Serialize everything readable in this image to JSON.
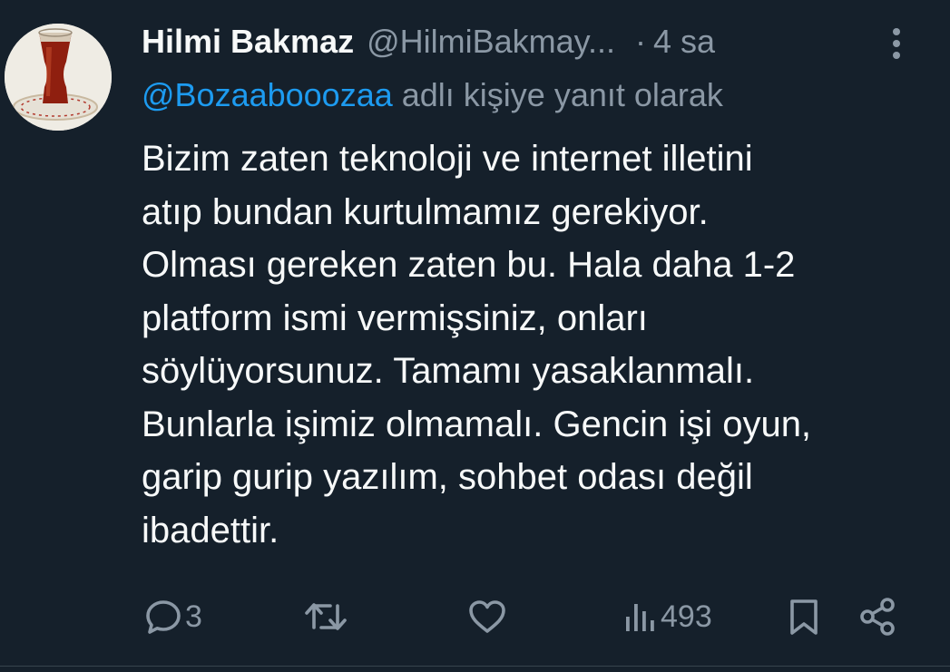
{
  "tweet": {
    "author_name": "Hilmi Bakmaz",
    "author_handle": "@HilmiBakmay...",
    "separator": "·",
    "time": "4 sa",
    "reply_to_handle": "@Bozaabooozaa",
    "reply_to_suffix": "adlı kişiye yanıt olarak",
    "body_lines": [
      "Bizim zaten teknoloji ve internet illetini",
      "atıp bundan kurtulmamız gerekiyor.",
      "Olması gereken zaten bu. Hala daha 1-2",
      "platform ismi vermişsiniz, onları",
      "söylüyorsunuz. Tamamı yasaklanmalı.",
      "Bunlarla işimiz olmamalı. Gencin işi oyun,",
      "garip gurip yazılım, sohbet odası değil",
      "ibadettir."
    ]
  },
  "actions": {
    "reply": {
      "icon": "reply-icon",
      "count": "3"
    },
    "retweet": {
      "icon": "retweet-icon",
      "count": ""
    },
    "like": {
      "icon": "heart-icon",
      "count": ""
    },
    "views": {
      "icon": "views-icon",
      "count": "493"
    },
    "bookmark": {
      "icon": "bookmark-icon"
    },
    "share": {
      "icon": "share-icon"
    }
  },
  "colors": {
    "background": "#15202b",
    "text_primary": "#f7f9f9",
    "text_secondary": "#8b98a5",
    "accent": "#1d9bf0"
  }
}
